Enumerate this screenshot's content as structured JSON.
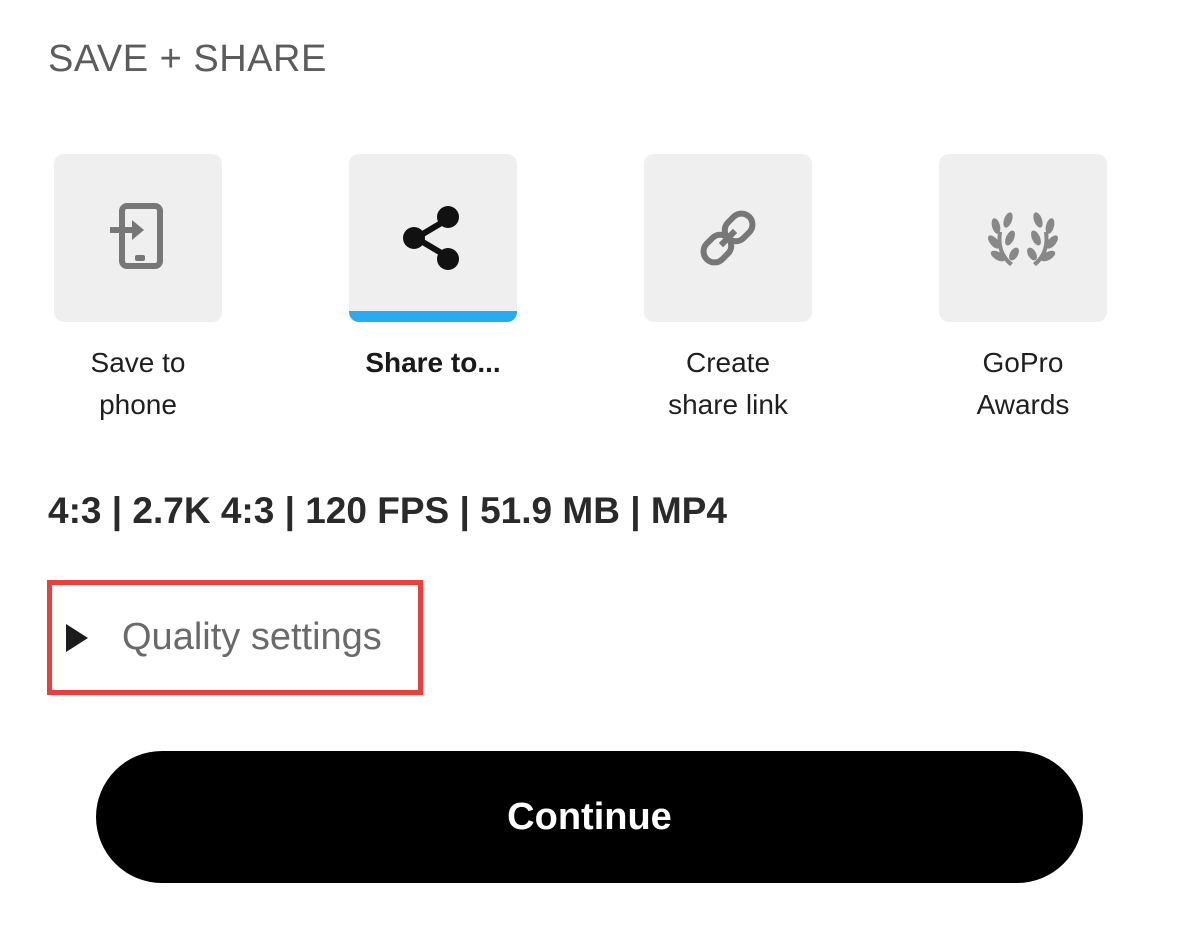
{
  "header": {
    "title": "SAVE + SHARE"
  },
  "share_options": [
    {
      "label_line1": "Save to",
      "label_line2": "phone",
      "icon": "save-to-phone-icon",
      "selected": false
    },
    {
      "label_line1": "Share to...",
      "label_line2": "",
      "icon": "share-icon",
      "selected": true
    },
    {
      "label_line1": "Create",
      "label_line2": "share link",
      "icon": "link-icon",
      "selected": false
    },
    {
      "label_line1": "GoPro",
      "label_line2": "Awards",
      "icon": "laurel-icon",
      "selected": false
    }
  ],
  "specs": {
    "text": "4:3 | 2.7K 4:3 | 120 FPS | 51.9 MB | MP4"
  },
  "quality": {
    "label": "Quality settings",
    "expanded": false
  },
  "actions": {
    "continue_label": "Continue"
  },
  "colors": {
    "accent": "#2aabf0",
    "tile_bg": "#efefef",
    "highlight_border": "#e8403a",
    "button_bg": "#000000"
  }
}
